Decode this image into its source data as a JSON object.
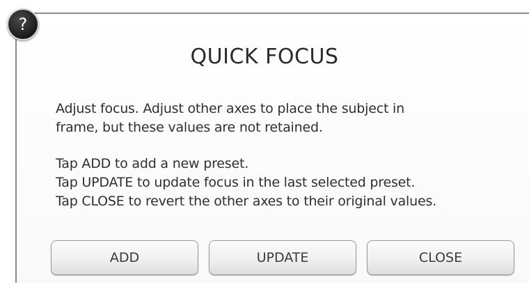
{
  "help_badge": {
    "glyph": "?",
    "icon": "help-icon"
  },
  "dialog": {
    "title": "QUICK FOCUS",
    "paragraphs": [
      {
        "lines": [
          "Adjust focus. Adjust other axes to place the subject in",
          "frame, but these values are not retained."
        ]
      },
      {
        "lines": [
          "Tap ADD to add a new preset.",
          "Tap UPDATE to update focus in the last selected preset.",
          "Tap CLOSE to revert the other axes to their original values."
        ]
      }
    ],
    "buttons": {
      "add": "ADD",
      "update": "UPDATE",
      "close": "CLOSE"
    }
  }
}
